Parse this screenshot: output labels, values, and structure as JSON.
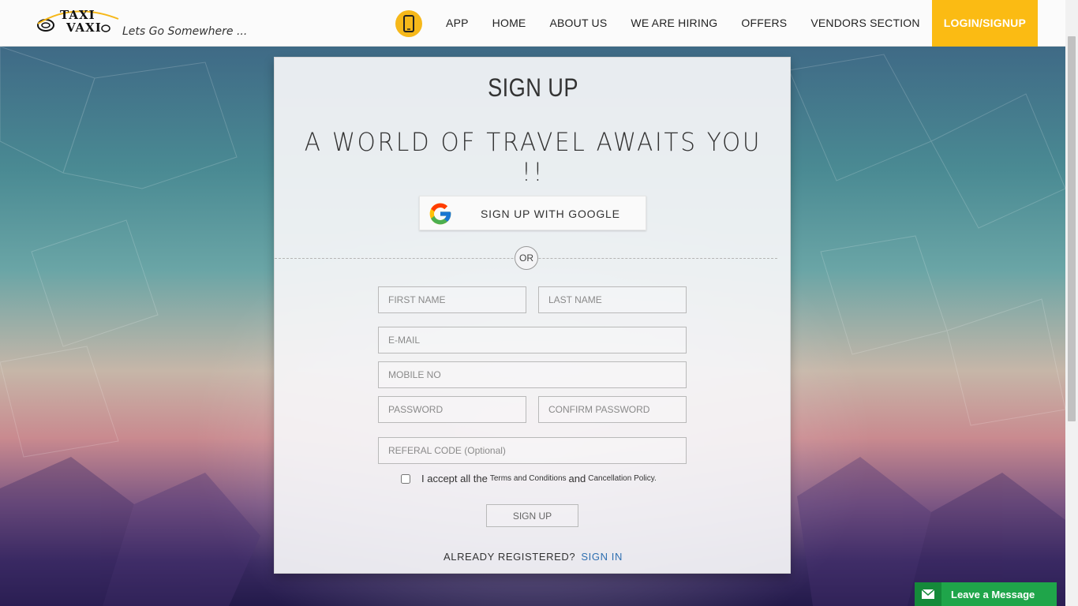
{
  "header": {
    "logo_line1": "TAXI",
    "logo_line2": "VAXI",
    "tagline": "Lets Go Somewhere ...",
    "nav": [
      {
        "label": "APP"
      },
      {
        "label": "HOME"
      },
      {
        "label": "ABOUT US"
      },
      {
        "label": "WE ARE HIRING"
      },
      {
        "label": "OFFERS"
      },
      {
        "label": "VENDORS SECTION"
      },
      {
        "label": "LOGIN/SIGNUP"
      }
    ],
    "app_icon": "mobile-phone-icon",
    "accent_color": "#FBBB13"
  },
  "form": {
    "title": "SIGN UP",
    "subtitle": "A WORLD OF TRAVEL AWAITS YOU !!",
    "google_label": "SIGN UP WITH GOOGLE",
    "or_label": "OR",
    "first_name_placeholder": "FIRST NAME",
    "last_name_placeholder": "LAST NAME",
    "email_placeholder": "E-MAIL",
    "mobile_placeholder": "MOBILE NO",
    "password_placeholder": "PASSWORD",
    "confirm_password_placeholder": "CONFIRM PASSWORD",
    "referral_placeholder": "REFERAL CODE (Optional)",
    "terms_prefix": "I accept all the",
    "terms_link": "Terms and Conditions",
    "terms_and": "and",
    "cancellation_link": "Cancellation Policy.",
    "submit_label": "SIGN UP",
    "already_label": "ALREADY REGISTERED?",
    "sign_in_label": "SIGN IN",
    "link_color": "#2E6FB0"
  },
  "chat": {
    "label": "Leave a Message",
    "icon": "envelope-icon",
    "color": "#1FA54A"
  }
}
